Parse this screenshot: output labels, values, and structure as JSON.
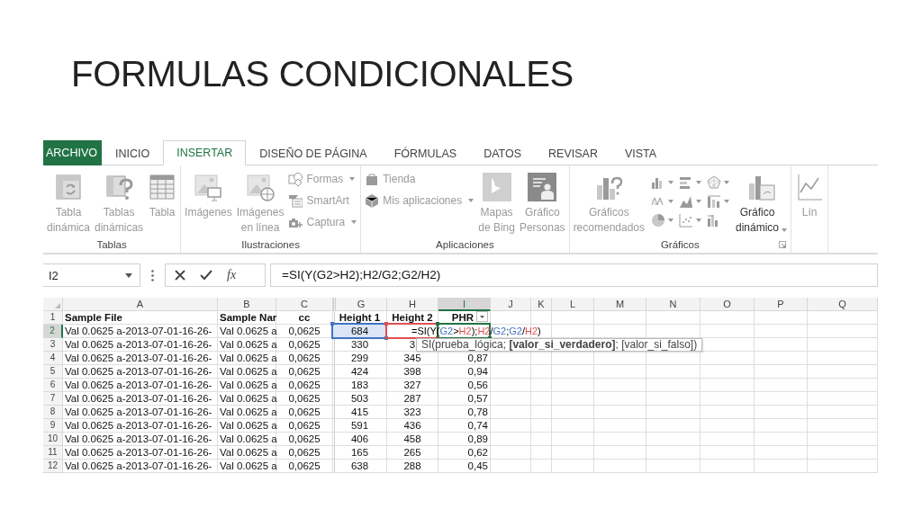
{
  "slide": {
    "title": "FORMULAS CONDICIONALES"
  },
  "ribbon": {
    "tabs": [
      {
        "label": "ARCHIVO",
        "kind": "file",
        "selected": false
      },
      {
        "label": "INICIO",
        "kind": "tab",
        "selected": false
      },
      {
        "label": "INSERTAR",
        "kind": "tab",
        "selected": true
      },
      {
        "label": "DISEÑO DE PÁGINA",
        "kind": "tab",
        "selected": false
      },
      {
        "label": "FÓRMULAS",
        "kind": "tab",
        "selected": false
      },
      {
        "label": "DATOS",
        "kind": "tab",
        "selected": false
      },
      {
        "label": "REVISAR",
        "kind": "tab",
        "selected": false
      },
      {
        "label": "VISTA",
        "kind": "tab",
        "selected": false
      }
    ],
    "groups": [
      {
        "label": "Tablas",
        "items": [
          {
            "kind": "large",
            "label": "Tabla\ndinámica",
            "disabled": true,
            "dropdown": false
          },
          {
            "kind": "large",
            "label": "Tablas\ndinámicas",
            "disabled": true,
            "dropdown": false
          },
          {
            "kind": "large",
            "label": "Tabla",
            "disabled": true,
            "dropdown": false
          }
        ]
      },
      {
        "label": "Ilustraciones",
        "items": [
          {
            "kind": "large",
            "label": "Imágenes",
            "disabled": true,
            "dropdown": false
          },
          {
            "kind": "large",
            "label": "Imágenes\nen línea",
            "disabled": true,
            "dropdown": false
          },
          {
            "kind": "stack",
            "children": [
              {
                "label": "Formas",
                "disabled": true,
                "dropdown": true
              },
              {
                "label": "SmartArt",
                "disabled": true,
                "dropdown": false
              },
              {
                "label": "Captura",
                "disabled": true,
                "dropdown": true
              }
            ]
          }
        ]
      },
      {
        "label": "Aplicaciones",
        "items": [
          {
            "kind": "stack",
            "children": [
              {
                "label": "Tienda",
                "disabled": true,
                "dropdown": false
              },
              {
                "label": "Mis aplicaciones",
                "disabled": true,
                "dropdown": true
              }
            ]
          },
          {
            "kind": "large",
            "label": "Mapas\nde Bing",
            "disabled": true,
            "dropdown": false
          },
          {
            "kind": "large",
            "label": "Gráfico\nPersonas",
            "disabled": true,
            "dropdown": false
          }
        ]
      },
      {
        "label": "Gráficos",
        "launcher": true,
        "items": [
          {
            "kind": "large",
            "label": "Gráficos\nrecomendados",
            "disabled": true,
            "dropdown": false
          },
          {
            "kind": "gallery",
            "buttons": [
              {
                "dropdown": true
              },
              {
                "dropdown": true
              },
              {
                "dropdown": true
              },
              {
                "dropdown": true
              },
              {
                "dropdown": true
              },
              {
                "dropdown": true
              },
              {
                "dropdown": true
              },
              {
                "dropdown": true
              },
              {
                "dropdown": false
              }
            ]
          },
          {
            "kind": "large",
            "label": "Gráfico\ndinámico",
            "disabled": false,
            "dropdown": true
          }
        ]
      },
      {
        "items": [
          {
            "kind": "large",
            "label": "Lín",
            "disabled": true,
            "dropdown": false
          }
        ]
      }
    ]
  },
  "formula_bar": {
    "name_box": "I2",
    "function_button": "fx",
    "formula": "=SI(Y(G2>H2);H2/G2;G2/H2)"
  },
  "sheet": {
    "columns": [
      {
        "label": "A",
        "selected": false
      },
      {
        "label": "B",
        "selected": false
      },
      {
        "label": "C",
        "selected": false
      },
      {
        "label": "G",
        "selected": false,
        "color": "#4472c4"
      },
      {
        "label": "H",
        "selected": false,
        "color": "#e05050"
      },
      {
        "label": "I",
        "selected": true,
        "color": "#217346"
      },
      {
        "label": "J",
        "selected": false
      },
      {
        "label": "K",
        "selected": false
      },
      {
        "label": "L",
        "selected": false
      },
      {
        "label": "M",
        "selected": false
      },
      {
        "label": "N",
        "selected": false
      },
      {
        "label": "O",
        "selected": false
      },
      {
        "label": "P",
        "selected": false
      },
      {
        "label": "Q",
        "selected": false
      }
    ],
    "rows": [
      {
        "number": "1",
        "selected": false,
        "header": true,
        "cells": {
          "A": "Sample File",
          "B": "Sample Nar",
          "C": "cc",
          "G": "Height 1",
          "H": "Height 2",
          "I": "PHR"
        }
      },
      {
        "number": "2",
        "selected": true,
        "header": false,
        "cells": {
          "A": "Val 0.0625 a-2013-07-01-16-26-",
          "B": "Val 0.0625 a",
          "C": "0,0625",
          "G": "684"
        }
      },
      {
        "number": "3",
        "selected": false,
        "header": false,
        "cells": {
          "A": "Val 0.0625 a-2013-07-01-16-26-",
          "B": "Val 0.0625 a",
          "C": "0,0625",
          "G": "330",
          "H": "3"
        }
      },
      {
        "number": "4",
        "selected": false,
        "header": false,
        "cells": {
          "A": "Val 0.0625 a-2013-07-01-16-26-",
          "B": "Val 0.0625 a",
          "C": "0,0625",
          "G": "299",
          "H": "345",
          "I": "0,87"
        }
      },
      {
        "number": "5",
        "selected": false,
        "header": false,
        "cells": {
          "A": "Val 0.0625 a-2013-07-01-16-26-",
          "B": "Val 0.0625 a",
          "C": "0,0625",
          "G": "424",
          "H": "398",
          "I": "0,94"
        }
      },
      {
        "number": "6",
        "selected": false,
        "header": false,
        "cells": {
          "A": "Val 0.0625 a-2013-07-01-16-26-",
          "B": "Val 0.0625 a",
          "C": "0,0625",
          "G": "183",
          "H": "327",
          "I": "0,56"
        }
      },
      {
        "number": "7",
        "selected": false,
        "header": false,
        "cells": {
          "A": "Val 0.0625 a-2013-07-01-16-26-",
          "B": "Val 0.0625 a",
          "C": "0,0625",
          "G": "503",
          "H": "287",
          "I": "0,57"
        }
      },
      {
        "number": "8",
        "selected": false,
        "header": false,
        "cells": {
          "A": "Val 0.0625 a-2013-07-01-16-26-",
          "B": "Val 0.0625 a",
          "C": "0,0625",
          "G": "415",
          "H": "323",
          "I": "0,78"
        }
      },
      {
        "number": "9",
        "selected": false,
        "header": false,
        "cells": {
          "A": "Val 0.0625 a-2013-07-01-16-26-",
          "B": "Val 0.0625 a",
          "C": "0,0625",
          "G": "591",
          "H": "436",
          "I": "0,74"
        }
      },
      {
        "number": "10",
        "selected": false,
        "header": false,
        "cells": {
          "A": "Val 0.0625 a-2013-07-01-16-26-",
          "B": "Val 0.0625 a",
          "C": "0,0625",
          "G": "406",
          "H": "458",
          "I": "0,89"
        }
      },
      {
        "number": "11",
        "selected": false,
        "header": false,
        "cells": {
          "A": "Val 0.0625 a-2013-07-01-16-26-",
          "B": "Val 0.0625 a",
          "C": "0,0625",
          "G": "165",
          "H": "265",
          "I": "0,62"
        }
      },
      {
        "number": "12",
        "selected": false,
        "header": false,
        "cells": {
          "A": "Val 0.0625 a-2013-07-01-16-26-",
          "B": "Val 0.0625 a",
          "C": "0,0625",
          "G": "638",
          "H": "288",
          "I": "0,45"
        }
      }
    ],
    "edit_formula": [
      {
        "text": "=SI(Y("
      },
      {
        "text": "G2",
        "color": "#4472c4"
      },
      {
        "text": ">"
      },
      {
        "text": "H2",
        "color": "#e05050"
      },
      {
        "text": ");"
      },
      {
        "text": "H2",
        "color": "#e05050"
      },
      {
        "text": "/"
      },
      {
        "text": "G2",
        "color": "#4472c4"
      },
      {
        "text": ";"
      },
      {
        "text": "G2",
        "color": "#4472c4"
      },
      {
        "text": "/"
      },
      {
        "text": "H2",
        "color": "#e05050"
      },
      {
        "text": ")"
      }
    ],
    "tooltip": "SI(prueba_lógica; **[valor_si_verdadero]**; [valor_si_falso])"
  }
}
